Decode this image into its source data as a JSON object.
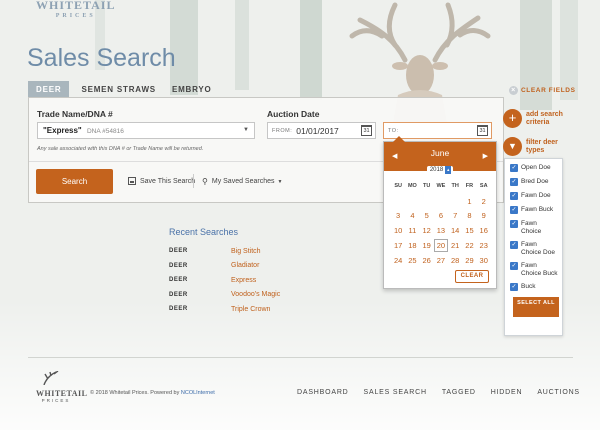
{
  "brand": {
    "name": "WHITETAIL",
    "sub": "PRICES",
    "accent": "#c4631d"
  },
  "page_title": "Sales Search",
  "tabs": [
    {
      "label": "DEER",
      "active": true
    },
    {
      "label": "SEMEN STRAWS",
      "active": false
    },
    {
      "label": "EMBRYO",
      "active": false
    }
  ],
  "clear_fields": "CLEAR FIELDS",
  "form": {
    "trade_label": "Trade Name/DNA #",
    "trade_value": "\"Express\"",
    "trade_dna": "DNA #54816",
    "hint": "Any sale associated with this DNA # or Trade Name will be returned.",
    "auction_label": "Auction Date",
    "from_prefix": "FROM:",
    "from_value": "01/01/2017",
    "to_prefix": "TO:",
    "to_value": "",
    "cal_icon_num": "31",
    "search_label": "Search",
    "save_label": "Save This Search",
    "my_saved_label": "My Saved Searches"
  },
  "side": {
    "add_criteria": "add search criteria",
    "filter_types": "filter deer types"
  },
  "deer_types": [
    {
      "label": "Open Doe",
      "checked": true
    },
    {
      "label": "Bred Doe",
      "checked": true
    },
    {
      "label": "Fawn Doe",
      "checked": true
    },
    {
      "label": "Fawn Buck",
      "checked": true
    },
    {
      "label": "Fawn Choice",
      "checked": true
    },
    {
      "label": "Fawn Choice Doe",
      "checked": true
    },
    {
      "label": "Fawn Choice Buck",
      "checked": true
    },
    {
      "label": "Buck",
      "checked": true
    }
  ],
  "select_all": "SELECT ALL",
  "calendar": {
    "month": "June",
    "year": "2018",
    "weekdays": [
      "SU",
      "MO",
      "TU",
      "WE",
      "TH",
      "FR",
      "SA"
    ],
    "weeks": [
      [
        "",
        "",
        "",
        "",
        "",
        "1",
        "2"
      ],
      [
        "3",
        "4",
        "5",
        "6",
        "7",
        "8",
        "9"
      ],
      [
        "10",
        "11",
        "12",
        "13",
        "14",
        "15",
        "16"
      ],
      [
        "17",
        "18",
        "19",
        "20",
        "21",
        "22",
        "23"
      ],
      [
        "24",
        "25",
        "26",
        "27",
        "28",
        "29",
        "30"
      ]
    ],
    "today": "20",
    "clear_label": "CLEAR"
  },
  "recent": {
    "title": "Recent Searches",
    "items": [
      {
        "type": "DEER",
        "name": "Big Stitch"
      },
      {
        "type": "DEER",
        "name": "Gladiator"
      },
      {
        "type": "DEER",
        "name": "Express"
      },
      {
        "type": "DEER",
        "name": "Voodoo's Magic"
      },
      {
        "type": "DEER",
        "name": "Triple Crown"
      }
    ]
  },
  "footer": {
    "copyright": "© 2018 Whitetail Prices. Powered by",
    "powered_by": "NCOLInternet",
    "nav": [
      "DASHBOARD",
      "SALES SEARCH",
      "TAGGED",
      "HIDDEN",
      "AUCTIONS"
    ]
  }
}
